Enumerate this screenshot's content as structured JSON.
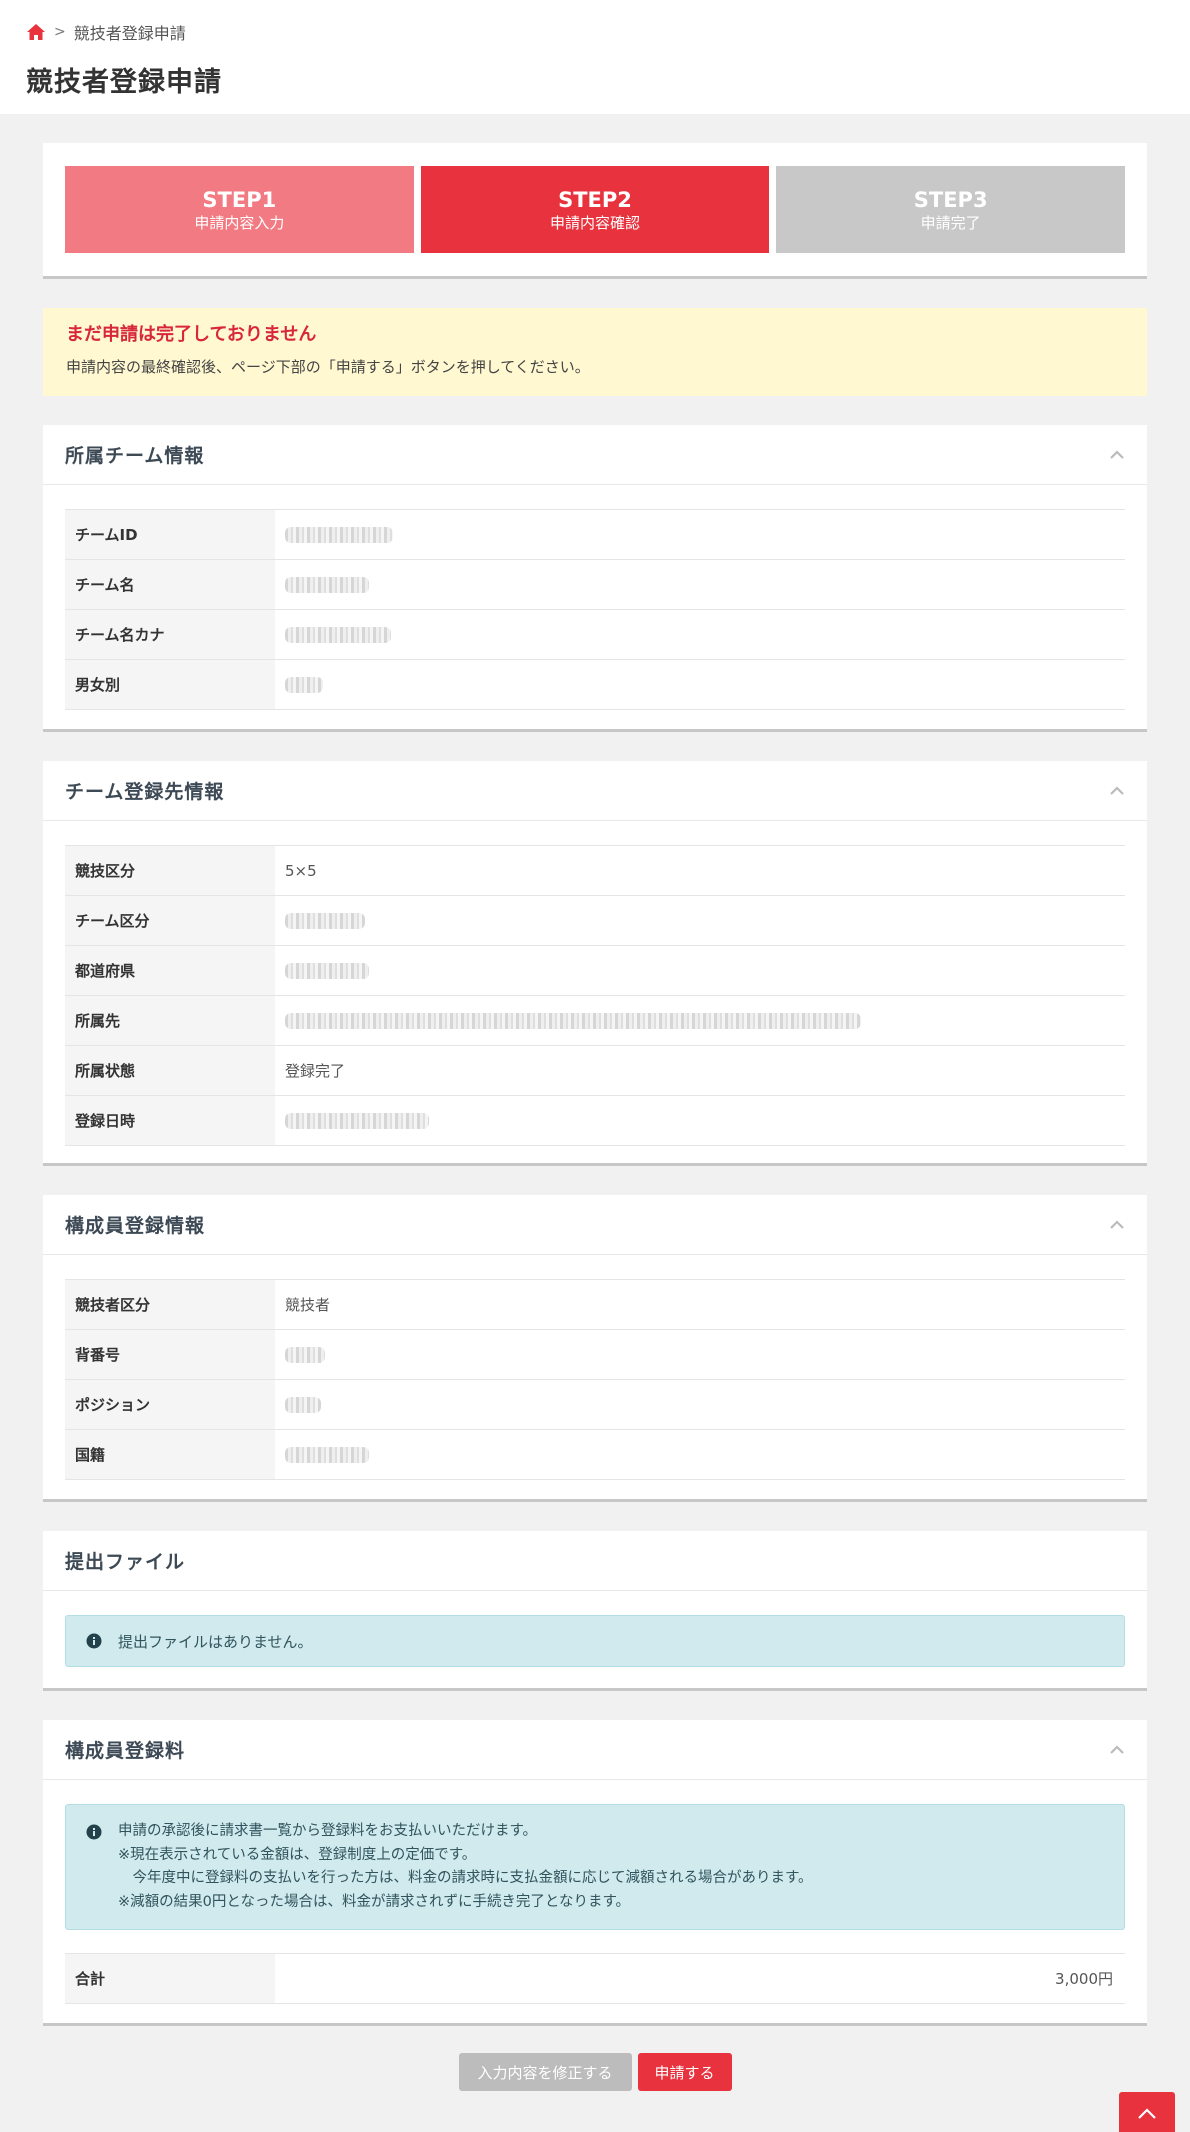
{
  "breadcrumb": {
    "current": "競技者登録申請"
  },
  "page_title": "競技者登録申請",
  "steps": [
    {
      "title": "STEP1",
      "sub": "申請内容入力"
    },
    {
      "title": "STEP2",
      "sub": "申請内容確認"
    },
    {
      "title": "STEP3",
      "sub": "申請完了"
    }
  ],
  "warning": {
    "title": "まだ申請は完了しておりません",
    "text": "申請内容の最終確認後、ページ下部の「申請する」ボタンを押してください。"
  },
  "team_info": {
    "title": "所属チーム情報",
    "rows": [
      {
        "label": "チームID"
      },
      {
        "label": "チーム名"
      },
      {
        "label": "チーム名カナ"
      },
      {
        "label": "男女別"
      }
    ]
  },
  "team_registration": {
    "title": "チーム登録先情報",
    "rows": [
      {
        "label": "競技区分",
        "value": "5×5"
      },
      {
        "label": "チーム区分"
      },
      {
        "label": "都道府県"
      },
      {
        "label": "所属先"
      },
      {
        "label": "所属状態",
        "value": "登録完了"
      },
      {
        "label": "登録日時"
      }
    ]
  },
  "member_info": {
    "title": "構成員登録情報",
    "rows": [
      {
        "label": "競技者区分",
        "value": "競技者"
      },
      {
        "label": "背番号"
      },
      {
        "label": "ポジション"
      },
      {
        "label": "国籍"
      }
    ]
  },
  "files": {
    "title": "提出ファイル",
    "notice": "提出ファイルはありません。"
  },
  "fee": {
    "title": "構成員登録料",
    "notice_lines": [
      "申請の承認後に請求書一覧から登録料をお支払いいただけます。",
      "※現在表示されている金額は、登録制度上の定価です。",
      "　今年度中に登録料の支払いを行った方は、料金の請求時に支払金額に応じて減額される場合があります。",
      "※減額の結果0円となった場合は、料金が請求されずに手続き完了となります。"
    ],
    "total_label": "合計",
    "total_value": "3,000円"
  },
  "buttons": {
    "edit": "入力内容を修正する",
    "submit": "申請する"
  },
  "colors": {
    "accent": "#e8333f",
    "step_done": "#f27a83",
    "step_todo": "#c8c8c8",
    "warning_bg": "#fff8d1",
    "info_bg": "#d0eaee"
  }
}
